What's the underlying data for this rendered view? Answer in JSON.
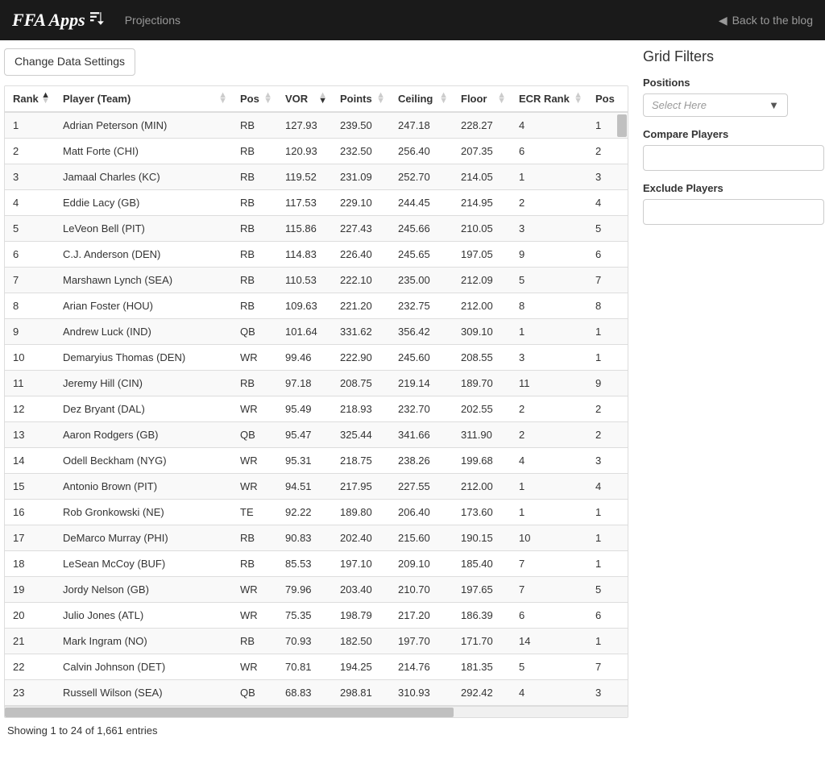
{
  "navbar": {
    "brand": "FFA Apps",
    "projections_link": "Projections",
    "back_link": "Back to the blog"
  },
  "toolbar": {
    "change_settings": "Change Data Settings"
  },
  "table": {
    "headers": {
      "rank": "Rank",
      "player": "Player (Team)",
      "pos": "Pos",
      "vor": "VOR",
      "points": "Points",
      "ceiling": "Ceiling",
      "floor": "Floor",
      "ecr_rank": "ECR Rank",
      "pos_rank": "Pos"
    },
    "rows": [
      {
        "rank": "1",
        "player": "Adrian Peterson (MIN)",
        "pos": "RB",
        "vor": "127.93",
        "points": "239.50",
        "ceiling": "247.18",
        "floor": "228.27",
        "ecr_rank": "4",
        "pos_rank": "1"
      },
      {
        "rank": "2",
        "player": "Matt Forte (CHI)",
        "pos": "RB",
        "vor": "120.93",
        "points": "232.50",
        "ceiling": "256.40",
        "floor": "207.35",
        "ecr_rank": "6",
        "pos_rank": "2"
      },
      {
        "rank": "3",
        "player": "Jamaal Charles (KC)",
        "pos": "RB",
        "vor": "119.52",
        "points": "231.09",
        "ceiling": "252.70",
        "floor": "214.05",
        "ecr_rank": "1",
        "pos_rank": "3"
      },
      {
        "rank": "4",
        "player": "Eddie Lacy (GB)",
        "pos": "RB",
        "vor": "117.53",
        "points": "229.10",
        "ceiling": "244.45",
        "floor": "214.95",
        "ecr_rank": "2",
        "pos_rank": "4"
      },
      {
        "rank": "5",
        "player": "LeVeon Bell (PIT)",
        "pos": "RB",
        "vor": "115.86",
        "points": "227.43",
        "ceiling": "245.66",
        "floor": "210.05",
        "ecr_rank": "3",
        "pos_rank": "5"
      },
      {
        "rank": "6",
        "player": "C.J. Anderson (DEN)",
        "pos": "RB",
        "vor": "114.83",
        "points": "226.40",
        "ceiling": "245.65",
        "floor": "197.05",
        "ecr_rank": "9",
        "pos_rank": "6"
      },
      {
        "rank": "7",
        "player": "Marshawn Lynch (SEA)",
        "pos": "RB",
        "vor": "110.53",
        "points": "222.10",
        "ceiling": "235.00",
        "floor": "212.09",
        "ecr_rank": "5",
        "pos_rank": "7"
      },
      {
        "rank": "8",
        "player": "Arian Foster (HOU)",
        "pos": "RB",
        "vor": "109.63",
        "points": "221.20",
        "ceiling": "232.75",
        "floor": "212.00",
        "ecr_rank": "8",
        "pos_rank": "8"
      },
      {
        "rank": "9",
        "player": "Andrew Luck (IND)",
        "pos": "QB",
        "vor": "101.64",
        "points": "331.62",
        "ceiling": "356.42",
        "floor": "309.10",
        "ecr_rank": "1",
        "pos_rank": "1"
      },
      {
        "rank": "10",
        "player": "Demaryius Thomas (DEN)",
        "pos": "WR",
        "vor": "99.46",
        "points": "222.90",
        "ceiling": "245.60",
        "floor": "208.55",
        "ecr_rank": "3",
        "pos_rank": "1"
      },
      {
        "rank": "11",
        "player": "Jeremy Hill (CIN)",
        "pos": "RB",
        "vor": "97.18",
        "points": "208.75",
        "ceiling": "219.14",
        "floor": "189.70",
        "ecr_rank": "11",
        "pos_rank": "9"
      },
      {
        "rank": "12",
        "player": "Dez Bryant (DAL)",
        "pos": "WR",
        "vor": "95.49",
        "points": "218.93",
        "ceiling": "232.70",
        "floor": "202.55",
        "ecr_rank": "2",
        "pos_rank": "2"
      },
      {
        "rank": "13",
        "player": "Aaron Rodgers (GB)",
        "pos": "QB",
        "vor": "95.47",
        "points": "325.44",
        "ceiling": "341.66",
        "floor": "311.90",
        "ecr_rank": "2",
        "pos_rank": "2"
      },
      {
        "rank": "14",
        "player": "Odell Beckham (NYG)",
        "pos": "WR",
        "vor": "95.31",
        "points": "218.75",
        "ceiling": "238.26",
        "floor": "199.68",
        "ecr_rank": "4",
        "pos_rank": "3"
      },
      {
        "rank": "15",
        "player": "Antonio Brown (PIT)",
        "pos": "WR",
        "vor": "94.51",
        "points": "217.95",
        "ceiling": "227.55",
        "floor": "212.00",
        "ecr_rank": "1",
        "pos_rank": "4"
      },
      {
        "rank": "16",
        "player": "Rob Gronkowski (NE)",
        "pos": "TE",
        "vor": "92.22",
        "points": "189.80",
        "ceiling": "206.40",
        "floor": "173.60",
        "ecr_rank": "1",
        "pos_rank": "1"
      },
      {
        "rank": "17",
        "player": "DeMarco Murray (PHI)",
        "pos": "RB",
        "vor": "90.83",
        "points": "202.40",
        "ceiling": "215.60",
        "floor": "190.15",
        "ecr_rank": "10",
        "pos_rank": "1"
      },
      {
        "rank": "18",
        "player": "LeSean McCoy (BUF)",
        "pos": "RB",
        "vor": "85.53",
        "points": "197.10",
        "ceiling": "209.10",
        "floor": "185.40",
        "ecr_rank": "7",
        "pos_rank": "1"
      },
      {
        "rank": "19",
        "player": "Jordy Nelson (GB)",
        "pos": "WR",
        "vor": "79.96",
        "points": "203.40",
        "ceiling": "210.70",
        "floor": "197.65",
        "ecr_rank": "7",
        "pos_rank": "5"
      },
      {
        "rank": "20",
        "player": "Julio Jones (ATL)",
        "pos": "WR",
        "vor": "75.35",
        "points": "198.79",
        "ceiling": "217.20",
        "floor": "186.39",
        "ecr_rank": "6",
        "pos_rank": "6"
      },
      {
        "rank": "21",
        "player": "Mark Ingram (NO)",
        "pos": "RB",
        "vor": "70.93",
        "points": "182.50",
        "ceiling": "197.70",
        "floor": "171.70",
        "ecr_rank": "14",
        "pos_rank": "1"
      },
      {
        "rank": "22",
        "player": "Calvin Johnson (DET)",
        "pos": "WR",
        "vor": "70.81",
        "points": "194.25",
        "ceiling": "214.76",
        "floor": "181.35",
        "ecr_rank": "5",
        "pos_rank": "7"
      },
      {
        "rank": "23",
        "player": "Russell Wilson (SEA)",
        "pos": "QB",
        "vor": "68.83",
        "points": "298.81",
        "ceiling": "310.93",
        "floor": "292.42",
        "ecr_rank": "4",
        "pos_rank": "3"
      }
    ],
    "info": "Showing 1 to 24 of 1,661 entries"
  },
  "filters": {
    "title": "Grid Filters",
    "positions_label": "Positions",
    "positions_placeholder": "Select Here",
    "compare_label": "Compare Players",
    "exclude_label": "Exclude Players"
  }
}
